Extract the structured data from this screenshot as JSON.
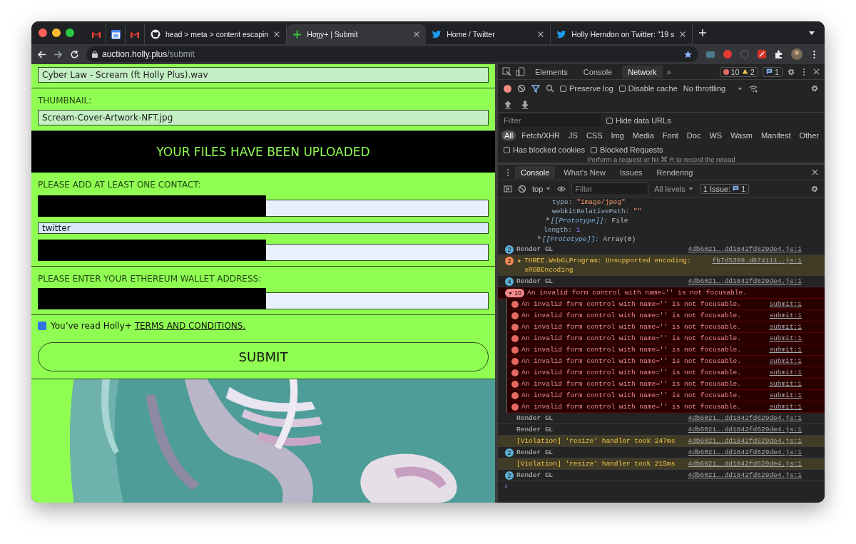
{
  "browser": {
    "tabs": [
      {
        "kind": "mail",
        "pinned": true,
        "selected": false
      },
      {
        "kind": "calendar",
        "pinned": true,
        "selected": false
      },
      {
        "kind": "mail",
        "pinned": true,
        "selected": false
      },
      {
        "kind": "octocat",
        "title": "head > meta > content escapin",
        "selected": false
      },
      {
        "kind": "plus",
        "title": "Hσʅʅy+ | Submit",
        "selected": true
      },
      {
        "kind": "bird",
        "title": "Home / Twitter",
        "selected": false
      },
      {
        "kind": "bird",
        "title": "Holly Herndon on Twitter: \"19 s",
        "selected": false
      }
    ],
    "address": {
      "host": "auction.holly.plus",
      "path": "/submit"
    }
  },
  "page": {
    "file_field": {
      "value": "Cyber Law - Scream (ft Holly Plus).wav"
    },
    "thumbnail": {
      "label": "THUMBNAIL:",
      "value": "Scream-Cover-Artwork-NFT.jpg"
    },
    "banner": "YOUR FILES HAVE BEEN UPLOADED",
    "contact": {
      "label": "PLEASE ADD AT LEAST ONE CONTACT:",
      "fields": [
        {
          "redacted": true
        },
        {
          "value": "twitter",
          "redacted": false
        },
        {
          "redacted": true
        }
      ]
    },
    "wallet": {
      "label": "PLEASE ENTER YOUR ETHEREUM WALLET ADDRESS:",
      "redacted": true
    },
    "terms": {
      "checked": true,
      "text": "You’ve read Holly+",
      "link": "TERMS AND CONDITIONS."
    },
    "submit": "SUBMIT"
  },
  "devtools": {
    "panel_tabs": [
      {
        "label": "Elements",
        "selected": false
      },
      {
        "label": "Console",
        "selected": false
      },
      {
        "label": "Network",
        "selected": true
      }
    ],
    "more": "»",
    "counts": {
      "errors": "10",
      "warnings": "2",
      "issues": "1"
    },
    "network": {
      "preserve_log": {
        "label": "Preserve log",
        "checked": false
      },
      "disable_cache": {
        "label": "Disable cache",
        "checked": false
      },
      "throttling": "No throttling",
      "filter_placeholder": "Filter",
      "hide_data_urls": {
        "label": "Hide data URLs",
        "checked": false
      },
      "type_filters": [
        {
          "label": "All",
          "selected": true
        },
        {
          "label": "Fetch/XHR",
          "selected": false
        },
        {
          "label": "JS",
          "selected": false
        },
        {
          "label": "CSS",
          "selected": false
        },
        {
          "label": "Img",
          "selected": false
        },
        {
          "label": "Media",
          "selected": false
        },
        {
          "label": "Font",
          "selected": false
        },
        {
          "label": "Doc",
          "selected": false
        },
        {
          "label": "WS",
          "selected": false
        },
        {
          "label": "Wasm",
          "selected": false
        },
        {
          "label": "Manifest",
          "selected": false
        },
        {
          "label": "Other",
          "selected": false
        }
      ],
      "blocked": [
        {
          "label": "Has blocked cookies",
          "checked": false
        },
        {
          "label": "Blocked Requests",
          "checked": false
        }
      ],
      "hint": "Perform a request or hit ⌘ R to record the reload"
    },
    "drawer_tabs": [
      {
        "label": "Console",
        "selected": true
      },
      {
        "label": "What's New",
        "selected": false
      },
      {
        "label": "Issues",
        "selected": false
      },
      {
        "label": "Rendering",
        "selected": false
      }
    ],
    "console_toolbar": {
      "context": "top",
      "filter_placeholder": "Filter",
      "levels": "All levels",
      "issues_label": "1 Issue:",
      "issues_count": "1"
    },
    "object_view": {
      "children": [
        {
          "children": [
            {
              "key": "type:",
              "value": "\"image/jpeg\"",
              "kind": "string"
            },
            {
              "key": "webkitRelativePath:",
              "value": "\"\"",
              "kind": "string"
            },
            {
              "key": "[[Prototype]]:",
              "value": "File",
              "kind": "proto",
              "expanded": false
            }
          ]
        },
        {
          "key": "length:",
          "value": "1",
          "kind": "number"
        },
        {
          "key": "[[Prototype]]:",
          "value": "Array(0)",
          "kind": "proto",
          "expanded": false
        }
      ]
    },
    "messages": [
      {
        "kind": "log",
        "count": "2",
        "text": "Render GL",
        "source": "4db6021….dd1842fd629de4.js:1"
      },
      {
        "kind": "warning",
        "count": "2",
        "expanded": false,
        "text": "THREE.WebGLProgram: Unsupported encoding: sRGBEncoding",
        "source": "fb7d5399.d874111….js:1"
      },
      {
        "kind": "log",
        "count": "4",
        "text": "Render GL",
        "source": "4db6021….dd1842fd629de4.js:1"
      },
      {
        "kind": "error_group",
        "count": "10",
        "expanded": true,
        "text": "An invalid form control with name='' is not focusable.",
        "children": [
          {
            "text": "An invalid form control with name='' is not focusable.",
            "source": "submit:1"
          },
          {
            "text": "An invalid form control with name='' is not focusable.",
            "source": "submit:1"
          },
          {
            "text": "An invalid form control with name='' is not focusable.",
            "source": "submit:1"
          },
          {
            "text": "An invalid form control with name='' is not focusable.",
            "source": "submit:1"
          },
          {
            "text": "An invalid form control with name='' is not focusable.",
            "source": "submit:1"
          },
          {
            "text": "An invalid form control with name='' is not focusable.",
            "source": "submit:1"
          },
          {
            "text": "An invalid form control with name='' is not focusable.",
            "source": "submit:1"
          },
          {
            "text": "An invalid form control with name='' is not focusable.",
            "source": "submit:1"
          },
          {
            "text": "An invalid form control with name='' is not focusable.",
            "source": "submit:1"
          },
          {
            "text": "An invalid form control with name='' is not focusable.",
            "source": "submit:1"
          }
        ]
      },
      {
        "kind": "log",
        "text": "Render GL",
        "source": "4db6021….dd1842fd629de4.js:1"
      },
      {
        "kind": "log",
        "text": "Render GL",
        "source": "4db6021….dd1842fd629de4.js:1"
      },
      {
        "kind": "violation",
        "text": "[Violation] 'resize' handler took 247ms",
        "source": "4db6021….dd1842fd629de4.js:1"
      },
      {
        "kind": "log",
        "count": "2",
        "text": "Render GL",
        "source": "4db6021….dd1842fd629de4.js:1"
      },
      {
        "kind": "violation",
        "text": "[Violation] 'resize' handler took 215ms",
        "source": "4db6021….dd1842fd629de4.js:1"
      },
      {
        "kind": "log",
        "count": "2",
        "text": "Render GL",
        "source": "4db6021….dd1842fd629de4.js:1"
      }
    ],
    "prompt": "›"
  }
}
